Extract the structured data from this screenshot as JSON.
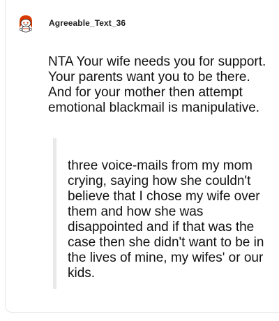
{
  "comment": {
    "username": "Agreeable_Text_36",
    "avatar_icon": "reddit-snoo-avatar-icon",
    "body": "NTA Your wife needs you for support. Your parents want you to be there. And for your mother then attempt emotional blackmail is manipulative.",
    "quote": "three voice-mails from my mom crying, saying how she couldn't believe that I chose my wife over them and how she was disappointed and if that was the case then she didn't want to be in the lives of mine, my wifes' or our kids."
  },
  "colors": {
    "quote_bar": "#e9e9e9",
    "thread_line": "#e6e6e6",
    "avatar_accent": "#d93a00"
  }
}
